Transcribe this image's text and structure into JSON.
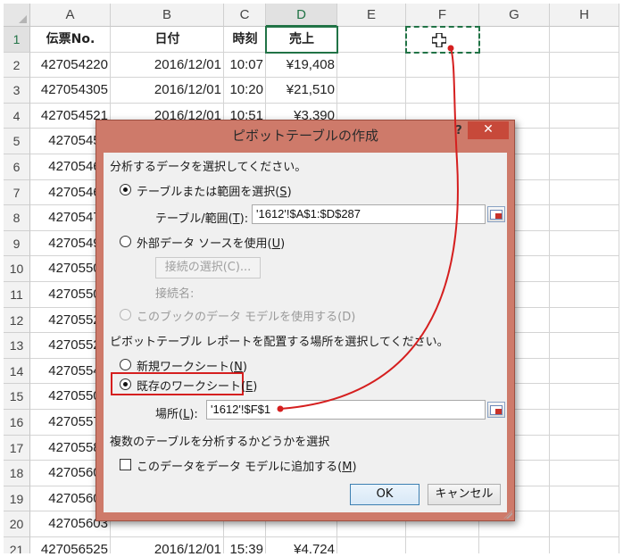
{
  "spreadsheet": {
    "columns": [
      "A",
      "B",
      "C",
      "D",
      "E",
      "F",
      "G",
      "H"
    ],
    "rows": [
      "1",
      "2",
      "3",
      "4",
      "5",
      "6",
      "7",
      "8",
      "9",
      "10",
      "11",
      "12",
      "13",
      "14",
      "15",
      "16",
      "17",
      "18",
      "19",
      "20",
      "21"
    ],
    "headers": {
      "a": "伝票No.",
      "b": "日付",
      "c": "時刻",
      "d": "売上"
    },
    "data": [
      [
        "427054220",
        "2016/12/01",
        "10:07",
        "¥19,408"
      ],
      [
        "427054305",
        "2016/12/01",
        "10:20",
        "¥21,510"
      ],
      [
        "427054521",
        "2016/12/01",
        "10:51",
        "¥3,390"
      ],
      [
        "42705453",
        "",
        "",
        ""
      ],
      [
        "42705464",
        "",
        "",
        ""
      ],
      [
        "42705465",
        "",
        "",
        ""
      ],
      [
        "42705473",
        "",
        "",
        ""
      ],
      [
        "42705493",
        "",
        "",
        ""
      ],
      [
        "42705503",
        "",
        "",
        ""
      ],
      [
        "42705504",
        "",
        "",
        ""
      ],
      [
        "42705521",
        "",
        "",
        ""
      ],
      [
        "42705522",
        "",
        "",
        ""
      ],
      [
        "42705541",
        "",
        "",
        ""
      ],
      [
        "42705503",
        "",
        "",
        ""
      ],
      [
        "42705571",
        "",
        "",
        ""
      ],
      [
        "42705581",
        "",
        "",
        ""
      ],
      [
        "42705601",
        "",
        "",
        ""
      ],
      [
        "42705603",
        "",
        "",
        ""
      ],
      [
        "42705603",
        "",
        "",
        ""
      ],
      [
        "427056525",
        "2016/12/01",
        "15:39",
        "¥4,724"
      ]
    ]
  },
  "dialog": {
    "title": "ピボットテーブルの作成",
    "help_label": "?",
    "close_label": "✕",
    "select_data_label": "分析するデータを選択してください。",
    "option_table_range": {
      "text": "テーブルまたは範囲を選択(",
      "key": "S",
      "end": ")"
    },
    "table_range_label": {
      "text": "テーブル/範囲(",
      "key": "T",
      "end": "):"
    },
    "table_range_value": "'1612'!$A$1:$D$287",
    "option_external": {
      "text": "外部データ ソースを使用(",
      "key": "U",
      "end": ")"
    },
    "choose_connection_label": "接続の選択(C)...",
    "connection_name_label": "接続名:",
    "option_data_model": "このブックのデータ モデルを使用する(D)",
    "place_report_label": "ピボットテーブル レポートを配置する場所を選択してください。",
    "option_new_sheet": {
      "text": "新規ワークシート(",
      "key": "N",
      "end": ")"
    },
    "option_existing_sheet": {
      "text": "既存のワークシート(",
      "key": "E",
      "end": ")"
    },
    "location_label": {
      "text": "場所(",
      "key": "L",
      "end": "):"
    },
    "location_value": "'1612'!$F$1",
    "multiple_tables_label": "複数のテーブルを分析するかどうかを選択",
    "add_to_model": {
      "text": "このデータをデータ モデルに追加する(",
      "key": "M",
      "end": ")"
    },
    "ok_label": "OK",
    "cancel_label": "キャンセル"
  },
  "colors": {
    "excel_green": "#217346",
    "dialog_frame": "#ce7a6a",
    "annotation_red": "#d51f1f",
    "close_red": "#c7493a"
  },
  "icons": {
    "cell_cursor": "plus-cross-cursor-icon",
    "range_picker": "range-select-icon"
  }
}
